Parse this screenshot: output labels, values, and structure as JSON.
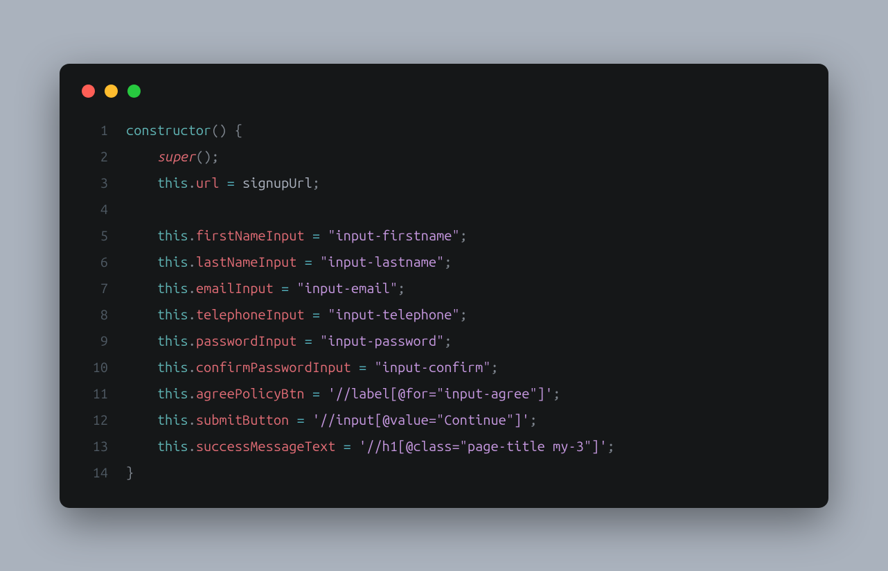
{
  "code": {
    "lines": [
      {
        "num": "1",
        "indent": "",
        "tokens": [
          {
            "t": "constructor",
            "c": "keyword"
          },
          {
            "t": "()",
            "c": "punc-dim"
          },
          {
            "t": " ",
            "c": "punc"
          },
          {
            "t": "{",
            "c": "punc-dim"
          }
        ]
      },
      {
        "num": "2",
        "indent": "    ",
        "tokens": [
          {
            "t": "super",
            "c": "super"
          },
          {
            "t": "()",
            "c": "punc-dim"
          },
          {
            "t": ";",
            "c": "punc-dim"
          }
        ]
      },
      {
        "num": "3",
        "indent": "    ",
        "tokens": [
          {
            "t": "this",
            "c": "keyword"
          },
          {
            "t": ".",
            "c": "punc-dim"
          },
          {
            "t": "url",
            "c": "prop"
          },
          {
            "t": " ",
            "c": "punc"
          },
          {
            "t": "=",
            "c": "op"
          },
          {
            "t": " ",
            "c": "punc"
          },
          {
            "t": "signupUrl",
            "c": "ident"
          },
          {
            "t": ";",
            "c": "punc-dim"
          }
        ]
      },
      {
        "num": "4",
        "indent": "",
        "tokens": []
      },
      {
        "num": "5",
        "indent": "    ",
        "tokens": [
          {
            "t": "this",
            "c": "keyword"
          },
          {
            "t": ".",
            "c": "punc-dim"
          },
          {
            "t": "firstNameInput",
            "c": "prop"
          },
          {
            "t": " ",
            "c": "punc"
          },
          {
            "t": "=",
            "c": "op"
          },
          {
            "t": " ",
            "c": "punc"
          },
          {
            "t": "\"input-firstname\"",
            "c": "string"
          },
          {
            "t": ";",
            "c": "punc-dim"
          }
        ]
      },
      {
        "num": "6",
        "indent": "    ",
        "tokens": [
          {
            "t": "this",
            "c": "keyword"
          },
          {
            "t": ".",
            "c": "punc-dim"
          },
          {
            "t": "lastNameInput",
            "c": "prop"
          },
          {
            "t": " ",
            "c": "punc"
          },
          {
            "t": "=",
            "c": "op"
          },
          {
            "t": " ",
            "c": "punc"
          },
          {
            "t": "\"input-lastname\"",
            "c": "string"
          },
          {
            "t": ";",
            "c": "punc-dim"
          }
        ]
      },
      {
        "num": "7",
        "indent": "    ",
        "tokens": [
          {
            "t": "this",
            "c": "keyword"
          },
          {
            "t": ".",
            "c": "punc-dim"
          },
          {
            "t": "emailInput",
            "c": "prop"
          },
          {
            "t": " ",
            "c": "punc"
          },
          {
            "t": "=",
            "c": "op"
          },
          {
            "t": " ",
            "c": "punc"
          },
          {
            "t": "\"input-email\"",
            "c": "string"
          },
          {
            "t": ";",
            "c": "punc-dim"
          }
        ]
      },
      {
        "num": "8",
        "indent": "    ",
        "tokens": [
          {
            "t": "this",
            "c": "keyword"
          },
          {
            "t": ".",
            "c": "punc-dim"
          },
          {
            "t": "telephoneInput",
            "c": "prop"
          },
          {
            "t": " ",
            "c": "punc"
          },
          {
            "t": "=",
            "c": "op"
          },
          {
            "t": " ",
            "c": "punc"
          },
          {
            "t": "\"input-telephone\"",
            "c": "string"
          },
          {
            "t": ";",
            "c": "punc-dim"
          }
        ]
      },
      {
        "num": "9",
        "indent": "    ",
        "tokens": [
          {
            "t": "this",
            "c": "keyword"
          },
          {
            "t": ".",
            "c": "punc-dim"
          },
          {
            "t": "passwordInput",
            "c": "prop"
          },
          {
            "t": " ",
            "c": "punc"
          },
          {
            "t": "=",
            "c": "op"
          },
          {
            "t": " ",
            "c": "punc"
          },
          {
            "t": "\"input-password\"",
            "c": "string"
          },
          {
            "t": ";",
            "c": "punc-dim"
          }
        ]
      },
      {
        "num": "10",
        "indent": "    ",
        "tokens": [
          {
            "t": "this",
            "c": "keyword"
          },
          {
            "t": ".",
            "c": "punc-dim"
          },
          {
            "t": "confirmPasswordInput",
            "c": "prop"
          },
          {
            "t": " ",
            "c": "punc"
          },
          {
            "t": "=",
            "c": "op"
          },
          {
            "t": " ",
            "c": "punc"
          },
          {
            "t": "\"input-confirm\"",
            "c": "string"
          },
          {
            "t": ";",
            "c": "punc-dim"
          }
        ]
      },
      {
        "num": "11",
        "indent": "    ",
        "tokens": [
          {
            "t": "this",
            "c": "keyword"
          },
          {
            "t": ".",
            "c": "punc-dim"
          },
          {
            "t": "agreePolicyBtn",
            "c": "prop"
          },
          {
            "t": " ",
            "c": "punc"
          },
          {
            "t": "=",
            "c": "op"
          },
          {
            "t": " ",
            "c": "punc"
          },
          {
            "t": "'//label[@for=\"input-agree\"]'",
            "c": "string"
          },
          {
            "t": ";",
            "c": "punc-dim"
          }
        ]
      },
      {
        "num": "12",
        "indent": "    ",
        "tokens": [
          {
            "t": "this",
            "c": "keyword"
          },
          {
            "t": ".",
            "c": "punc-dim"
          },
          {
            "t": "submitButton",
            "c": "prop"
          },
          {
            "t": " ",
            "c": "punc"
          },
          {
            "t": "=",
            "c": "op"
          },
          {
            "t": " ",
            "c": "punc"
          },
          {
            "t": "'//input[@value=\"Continue\"]'",
            "c": "string"
          },
          {
            "t": ";",
            "c": "punc-dim"
          }
        ]
      },
      {
        "num": "13",
        "indent": "    ",
        "tokens": [
          {
            "t": "this",
            "c": "keyword"
          },
          {
            "t": ".",
            "c": "punc-dim"
          },
          {
            "t": "successMessageText",
            "c": "prop"
          },
          {
            "t": " ",
            "c": "punc"
          },
          {
            "t": "=",
            "c": "op"
          },
          {
            "t": " ",
            "c": "punc"
          },
          {
            "t": "'//h1[@class=\"page-title my-3\"]'",
            "c": "string"
          },
          {
            "t": ";",
            "c": "punc-dim"
          }
        ]
      },
      {
        "num": "14",
        "indent": "",
        "tokens": [
          {
            "t": "}",
            "c": "punc-dim"
          }
        ]
      }
    ]
  }
}
